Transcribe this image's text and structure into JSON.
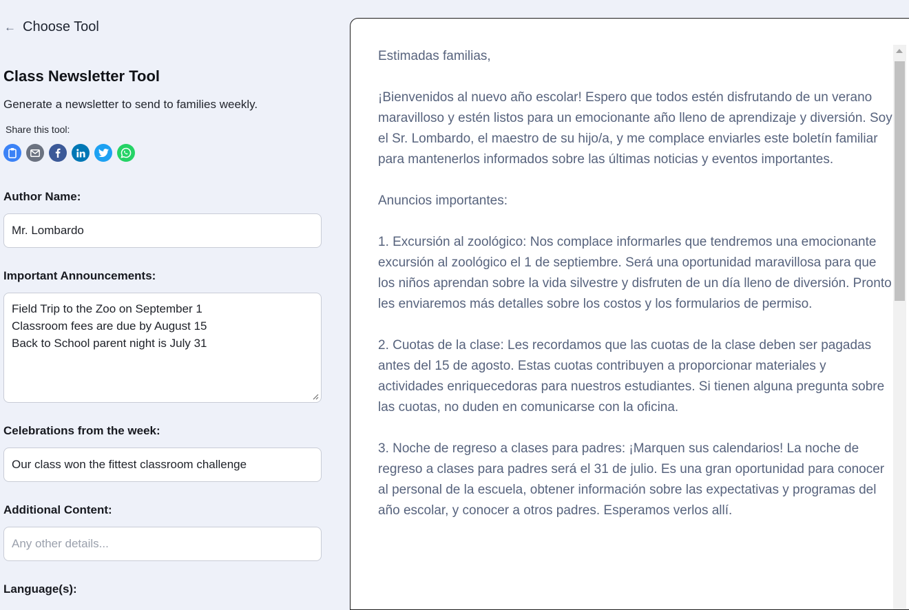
{
  "nav": {
    "back_label": "Choose Tool",
    "back_icon": "arrow-left-icon"
  },
  "tool": {
    "title": "Class Newsletter Tool",
    "subtitle": "Generate a newsletter to send to families weekly.",
    "share_label": "Share this tool:",
    "share_icons": [
      {
        "name": "clipboard-icon",
        "color": "#3b82f6"
      },
      {
        "name": "email-icon",
        "color": "#6b7280"
      },
      {
        "name": "facebook-icon",
        "color": "#3b5998"
      },
      {
        "name": "linkedin-icon",
        "color": "#0077b5"
      },
      {
        "name": "twitter-icon",
        "color": "#1da1f2"
      },
      {
        "name": "whatsapp-icon",
        "color": "#25d366"
      }
    ]
  },
  "form": {
    "author_label": "Author Name:",
    "author_value": "Mr. Lombardo",
    "announcements_label": "Important Announcements:",
    "announcements_lines": [
      "Field Trip to the Zoo on September 1",
      "Classroom fees are due by August 15",
      "Back to School parent night is July 31"
    ],
    "celebrations_label": "Celebrations from the week:",
    "celebrations_value": "Our class won the fittest classroom challenge",
    "additional_label": "Additional Content:",
    "additional_placeholder": "Any other details...",
    "language_label": "Language(s):"
  },
  "output": {
    "paragraphs": [
      "Estimadas familias,",
      "¡Bienvenidos al nuevo año escolar! Espero que todos estén disfrutando de un verano maravilloso y estén listos para un emocionante año lleno de aprendizaje y diversión. Soy el Sr. Lombardo, el maestro de su hijo/a, y me complace enviarles este boletín familiar para mantenerlos informados sobre las últimas noticias y eventos importantes.",
      "Anuncios importantes:",
      "1. Excursión al zoológico: Nos complace informarles que tendremos una emocionante excursión al zoológico el 1 de septiembre. Será una oportunidad maravillosa para que los niños aprendan sobre la vida silvestre y disfruten de un día lleno de diversión. Pronto les enviaremos más detalles sobre los costos y los formularios de permiso.",
      "2. Cuotas de la clase: Les recordamos que las cuotas de la clase deben ser pagadas antes del 15 de agosto. Estas cuotas contribuyen a proporcionar materiales y actividades enriquecedoras para nuestros estudiantes. Si tienen alguna pregunta sobre las cuotas, no duden en comunicarse con la oficina.",
      "3. Noche de regreso a clases para padres: ¡Marquen sus calendarios! La noche de regreso a clases para padres será el 31 de julio. Es una gran oportunidad para conocer al personal de la escuela, obtener información sobre las expectativas y programas del año escolar, y conocer a otros padres. Esperamos verlos allí."
    ]
  }
}
